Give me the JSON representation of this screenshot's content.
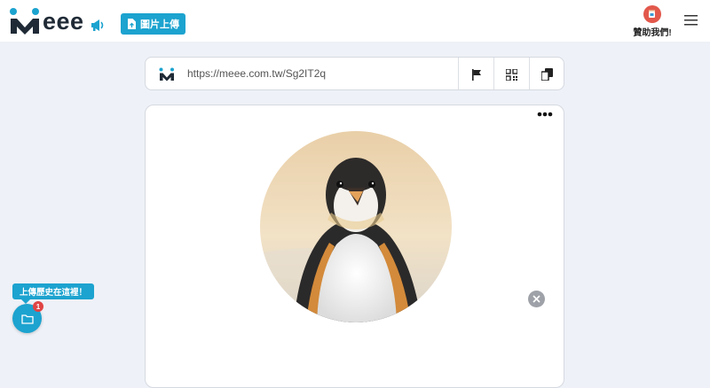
{
  "header": {
    "logo_text": "eee",
    "upload_label": "圖片上傳",
    "sponsor_label": "贊助我們!"
  },
  "urlbar": {
    "url": "https://meee.com.tw/Sg2IT2q",
    "actions": [
      "flag-icon",
      "qr-code-icon",
      "copy-icon"
    ]
  },
  "history": {
    "tip": "上傳歷史在這裡！",
    "badge_count": "1"
  },
  "colors": {
    "accent": "#1ca3cf",
    "background": "#eef1f7",
    "badge": "#e04444"
  }
}
